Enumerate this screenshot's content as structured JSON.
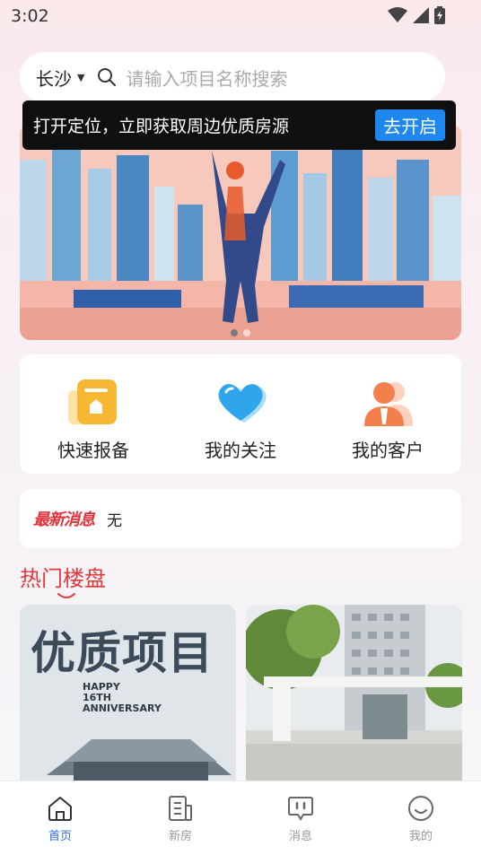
{
  "status_bar": {
    "time": "3:02"
  },
  "search": {
    "city": "长沙",
    "placeholder": "请输入项目名称搜索"
  },
  "location_tooltip": {
    "message": "打开定位，立即获取周边优质房源",
    "button": "去开启"
  },
  "banner": {
    "dot_count": 2,
    "active_dot": 0
  },
  "quick_actions": [
    {
      "label": "快速报备",
      "icon": "report-folder-icon"
    },
    {
      "label": "我的关注",
      "icon": "heart-icon"
    },
    {
      "label": "我的客户",
      "icon": "customers-icon"
    }
  ],
  "news": {
    "logo_text": "最新消息",
    "content": "无"
  },
  "hot_section": {
    "title": "热门楼盘"
  },
  "projects": [
    {
      "title": "优质项目",
      "anniversary": [
        "HAPPY",
        "16TH",
        "ANNIVERSARY"
      ]
    },
    {
      "title": ""
    }
  ],
  "tabs": [
    {
      "label": "首页",
      "icon": "home-icon",
      "active": true
    },
    {
      "label": "新房",
      "icon": "new-house-icon",
      "active": false
    },
    {
      "label": "消息",
      "icon": "message-icon",
      "active": false
    },
    {
      "label": "我的",
      "icon": "profile-icon",
      "active": false
    }
  ],
  "colors": {
    "accent": "#2f6fe6",
    "tooltip_button": "#1e88f0",
    "hot_title": "#e23a3a"
  }
}
